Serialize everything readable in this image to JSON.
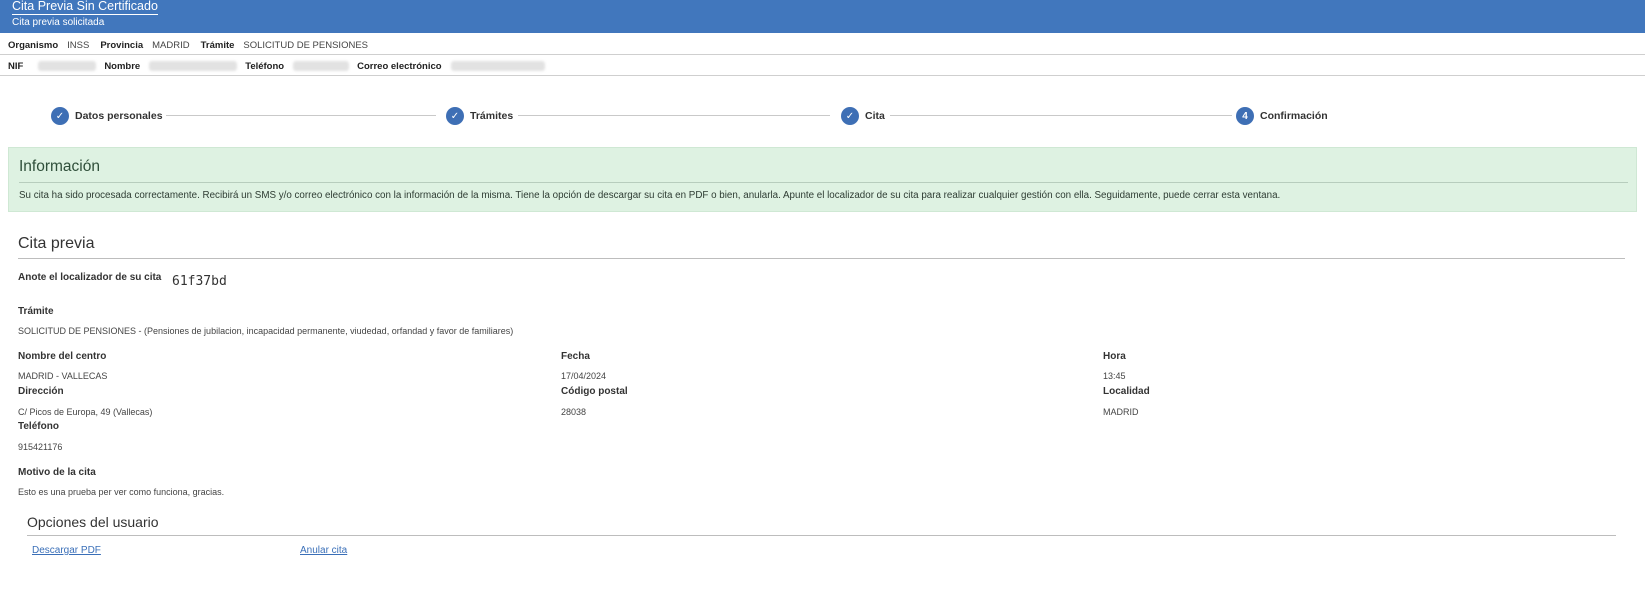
{
  "header": {
    "title": "Cita Previa Sin Certificado",
    "subtitle": "Cita previa solicitada"
  },
  "summary": {
    "organismo_label": "Organismo",
    "organismo_value": "INSS",
    "provincia_label": "Provincia",
    "provincia_value": "MADRID",
    "tramite_label": "Trámite",
    "tramite_value": "SOLICITUD DE PENSIONES"
  },
  "personal": {
    "nif_label": "NIF",
    "nombre_label": "Nombre",
    "telefono_label": "Teléfono",
    "correo_label": "Correo electrónico"
  },
  "stepper": {
    "steps": [
      {
        "label": "Datos personales",
        "icon": "check-icon",
        "done": true
      },
      {
        "label": "Trámites",
        "icon": "check-icon",
        "done": true
      },
      {
        "label": "Cita",
        "icon": "check-icon",
        "done": true
      },
      {
        "label": "Confirmación",
        "number": "4",
        "done": false
      }
    ]
  },
  "info": {
    "title": "Información",
    "text": "Su cita ha sido procesada correctamente. Recibirá un SMS y/o correo electrónico con la información de la misma. Tiene la opción de descargar su cita en PDF o bien, anularla. Apunte el localizador de su cita para realizar cualquier gestión con ella. Seguidamente, puede cerrar esta ventana."
  },
  "cita": {
    "section_title": "Cita previa",
    "locator_label": "Anote el localizador de su cita",
    "locator_value": "61f37bd",
    "tramite_label": "Trámite",
    "tramite_value": "SOLICITUD DE PENSIONES - (Pensiones de jubilacion, incapacidad permanente, viudedad, orfandad y favor de familiares)",
    "centro_label": "Nombre del centro",
    "centro_value": "MADRID - VALLECAS",
    "fecha_label": "Fecha",
    "fecha_value": "17/04/2024",
    "hora_label": "Hora",
    "hora_value": "13:45",
    "direccion_label": "Dirección",
    "direccion_value": "C/ Picos de Europa, 49 (Vallecas)",
    "cp_label": "Código postal",
    "cp_value": "28038",
    "localidad_label": "Localidad",
    "localidad_value": "MADRID",
    "telefono_label": "Teléfono",
    "telefono_value": "915421176",
    "motivo_label": "Motivo de la cita",
    "motivo_value": "Esto es una prueba per ver como funciona, gracias."
  },
  "options": {
    "title": "Opciones del usuario",
    "download_label": "Descargar PDF",
    "cancel_label": "Anular cita"
  },
  "colors": {
    "header_bg": "#4177bd",
    "step_circle": "#3e6fb5",
    "alert_bg": "#def2e2",
    "link": "#3a6fb8"
  }
}
